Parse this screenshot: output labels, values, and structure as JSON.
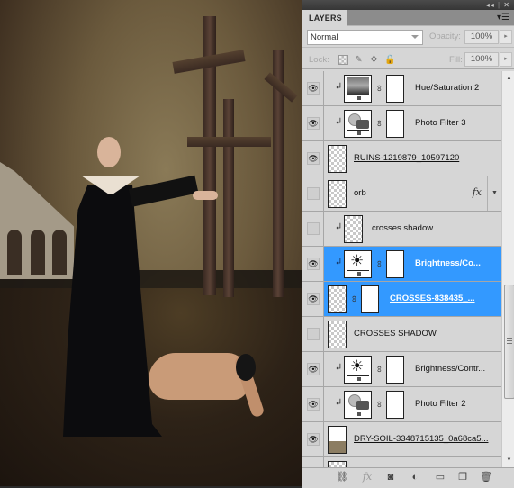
{
  "panel": {
    "title": "LAYERS",
    "titlebar_icons": [
      "collapse-icon",
      "close-icon"
    ],
    "collapse_glyph": "◂◂",
    "close_glyph": "✕",
    "menu_glyph": "▾☰",
    "blend_mode": "Normal",
    "opacity_label": "Opacity:",
    "opacity_value": "100%",
    "lock_label": "Lock:",
    "fill_label": "Fill:",
    "fill_value": "100%",
    "arrow_glyph": "▸"
  },
  "layers": [
    {
      "name": "Hue/Saturation 2",
      "visible": true,
      "clipped": true,
      "type": "hue-saturation",
      "has_mask": true,
      "underline": false,
      "selected": false
    },
    {
      "name": "Photo Filter 3",
      "visible": true,
      "clipped": true,
      "type": "photo-filter",
      "has_mask": true,
      "underline": false,
      "selected": false
    },
    {
      "name": "RUINS-1219879_10597120",
      "visible": true,
      "clipped": false,
      "type": "pixel",
      "has_mask": false,
      "underline": true,
      "selected": false
    },
    {
      "name": "orb",
      "visible": false,
      "clipped": false,
      "type": "pixel",
      "has_mask": false,
      "underline": false,
      "selected": false,
      "fx": "fx"
    },
    {
      "name": "crosses shadow",
      "visible": false,
      "clipped": true,
      "type": "pixel",
      "has_mask": false,
      "underline": false,
      "selected": false
    },
    {
      "name": "Brightness/Co...",
      "visible": true,
      "clipped": true,
      "type": "brightness-contrast",
      "has_mask": true,
      "underline": false,
      "selected": true
    },
    {
      "name": "CROSSES-838435_...",
      "visible": true,
      "clipped": false,
      "type": "pixel",
      "has_mask": true,
      "underline": true,
      "selected": true
    },
    {
      "name": "CROSSES SHADOW",
      "visible": false,
      "clipped": false,
      "type": "pixel",
      "has_mask": false,
      "underline": false,
      "selected": false
    },
    {
      "name": "Brightness/Contr...",
      "visible": true,
      "clipped": true,
      "type": "brightness-contrast",
      "has_mask": true,
      "underline": false,
      "selected": false
    },
    {
      "name": "Photo Filter 2",
      "visible": true,
      "clipped": true,
      "type": "photo-filter",
      "has_mask": true,
      "underline": false,
      "selected": false
    },
    {
      "name": "DRY-SOIL-3348715135_0a68ca5...",
      "visible": true,
      "clipped": false,
      "type": "pixel",
      "has_mask": false,
      "underline": true,
      "selected": false
    },
    {
      "name": "",
      "visible": false,
      "clipped": false,
      "type": "pixel",
      "has_mask": false,
      "underline": false,
      "selected": false
    }
  ],
  "glyphs": {
    "eye": "👁",
    "clip": "↲",
    "chain": "⛓",
    "sun": "☀",
    "scroll_up": "▲",
    "scroll_down": "▼",
    "fx_toggle": "▼"
  },
  "bottom_bar": [
    {
      "name": "link-layers-icon",
      "glyph": "⛓"
    },
    {
      "name": "layer-style-icon",
      "glyph": "fx"
    },
    {
      "name": "add-mask-icon",
      "glyph": "◙"
    },
    {
      "name": "adjustment-layer-icon",
      "glyph": "◐"
    },
    {
      "name": "new-group-icon",
      "glyph": "▭"
    },
    {
      "name": "new-layer-icon",
      "glyph": "❐"
    },
    {
      "name": "delete-layer-icon",
      "glyph": "🗑"
    }
  ],
  "colors": {
    "selected": "#3399ff",
    "panel_bg": "#d6d6d6"
  }
}
